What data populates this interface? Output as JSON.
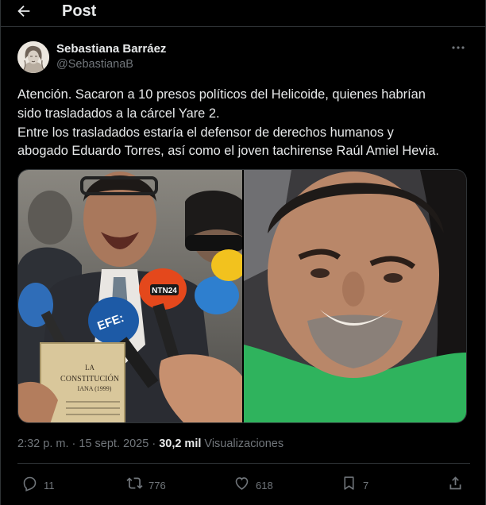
{
  "header": {
    "title": "Post",
    "back_icon": "arrow-left-icon"
  },
  "author": {
    "name": "Sebastiana Barráez",
    "handle": "@SebastianaB",
    "avatar": "sketch-portrait-avatar",
    "more_icon": "more-horizontal-icon"
  },
  "tweet": {
    "lines": [
      "Atención. Sacaron a 10 presos políticos del Helicoide, quienes habrían",
      "sido trasladados a la cárcel Yare 2.",
      "Entre los trasladados estaría el defensor de derechos humanos y",
      "abogado Eduardo Torres, así como el joven tachirense Raúl Amiel Hevia."
    ],
    "media": {
      "left_photo": {
        "description_icon": "press-conference-photo",
        "mic_labels": [
          "NTN24",
          "EFE:"
        ],
        "document_lines": [
          "LA",
          "CONSTITUCIÓN",
          "IANA (1999)"
        ]
      },
      "right_photo": {
        "description_icon": "selfie-photo"
      }
    }
  },
  "meta": {
    "time": "2:32 p. m.",
    "separator": "·",
    "date": "15 sept. 2025",
    "views_count": "30,2 mil",
    "views_label": "Visualizaciones"
  },
  "actions": {
    "replies": "11",
    "reposts": "776",
    "likes": "618",
    "bookmarks": "7"
  },
  "colors": {
    "background": "#000000",
    "text": "#e7e9ea",
    "muted": "#71767b",
    "border": "#2f3336"
  }
}
